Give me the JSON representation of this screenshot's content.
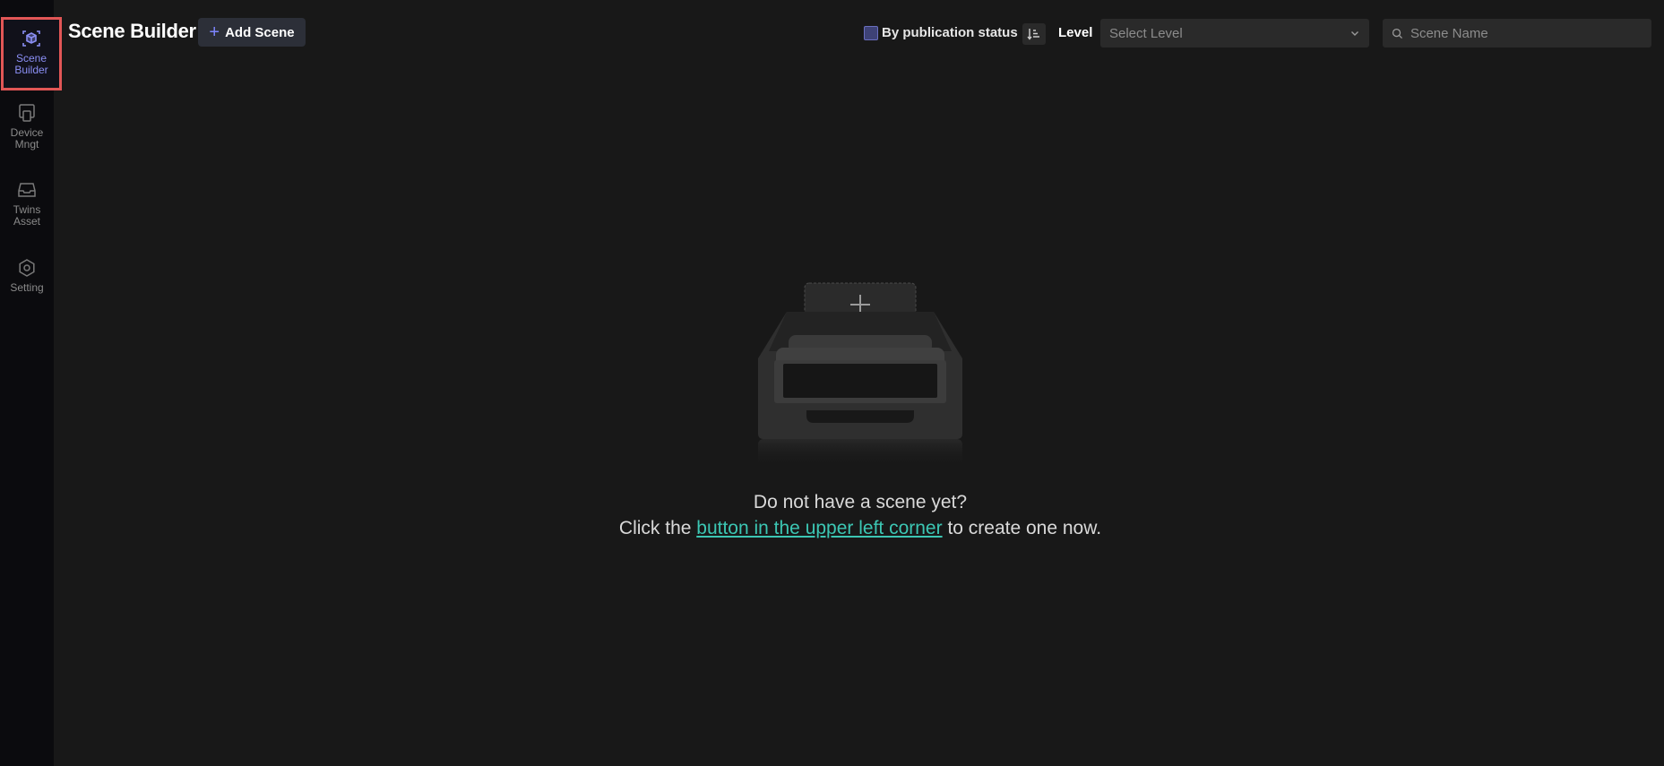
{
  "sidebar": {
    "items": [
      {
        "label": "Scene Builder",
        "icon": "scene-builder-icon",
        "active": true
      },
      {
        "label": "Device Mngt",
        "icon": "device-icon",
        "active": false
      },
      {
        "label": "Twins Asset",
        "icon": "inbox-icon",
        "active": false
      },
      {
        "label": "Setting",
        "icon": "gear-icon",
        "active": false
      }
    ]
  },
  "header": {
    "title": "Scene Builder",
    "add_button_label": "Add Scene",
    "publication_filter_label": "By publication status",
    "level_label": "Level",
    "level_placeholder": "Select Level",
    "search_placeholder": "Scene Name"
  },
  "empty_state": {
    "line1": "Do not have a scene yet?",
    "line2_prefix": "Click the ",
    "line2_link": "button in the upper left corner",
    "line2_suffix": " to create one now."
  },
  "colors": {
    "background": "#181818",
    "sidebar": "#0b0b0e",
    "accent": "#7e86ff",
    "link": "#3cc6b3",
    "active_outline": "#e25656"
  }
}
